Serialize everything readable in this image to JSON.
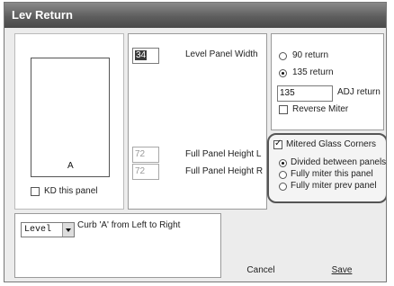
{
  "window": {
    "title": "Lev Return"
  },
  "preview": {
    "panel_letter": "A"
  },
  "kd_panel": {
    "label": "KD this panel",
    "checked": false
  },
  "level_panel_width": {
    "label": "Level Panel Width",
    "value": "34"
  },
  "full_panel_height_l": {
    "label": "Full Panel Height L",
    "value": "72"
  },
  "full_panel_height_r": {
    "label": "Full Panel Height R",
    "value": "72"
  },
  "return_options": {
    "items": [
      {
        "label": "90 return",
        "selected": false
      },
      {
        "label": "135 return",
        "selected": true
      }
    ]
  },
  "adj_return": {
    "label": "ADJ return",
    "value": "135"
  },
  "reverse_miter": {
    "label": "Reverse Miter",
    "checked": false
  },
  "mitered_glass": {
    "label": "Mitered Glass Corners",
    "checked": true,
    "options": [
      {
        "label": "Divided between panels",
        "selected": true
      },
      {
        "label": "Fully miter this panel",
        "selected": false
      },
      {
        "label": "Fully miter prev panel",
        "selected": false
      }
    ]
  },
  "curb": {
    "selected": "Level",
    "label": "Curb 'A' from Left to Right"
  },
  "buttons": {
    "cancel": "Cancel",
    "save": "Save"
  }
}
